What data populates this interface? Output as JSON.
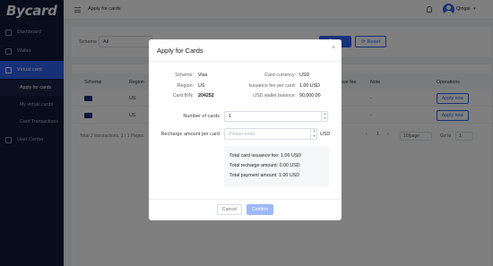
{
  "brand": {
    "logo": "Bycard",
    "accent": "#2f63f2",
    "sidebar_bg": "#0f1a35"
  },
  "sidebar": {
    "items": [
      {
        "label": "Dashboard",
        "icon": "dashboard-icon"
      },
      {
        "label": "Wallet",
        "icon": "wallet-icon"
      },
      {
        "label": "Virtual card",
        "icon": "card-icon",
        "active": true
      },
      {
        "label": "User Center",
        "icon": "user-icon"
      }
    ],
    "subitems": [
      {
        "label": "Apply for cards",
        "active": true
      },
      {
        "label": "My virtual cards"
      },
      {
        "label": "Card Transactions"
      }
    ]
  },
  "topbar": {
    "title": "Apply for cards",
    "user": "Qingsi",
    "user_chevron": "▾"
  },
  "filter": {
    "scheme_label": "Scheme",
    "scheme_value": "All",
    "query_label": "Query",
    "reset_label": "Reset"
  },
  "table": {
    "headers": [
      "Scheme",
      "Region",
      "Issue fee",
      "Note",
      "Operations"
    ],
    "rows": [
      {
        "scheme_icon": "visa-icon",
        "region": "US",
        "note": "-",
        "action": "Apply now"
      },
      {
        "scheme_icon": "visa-icon",
        "region": "US",
        "note": "-",
        "action": "Apply now"
      }
    ],
    "total": "Total 2 transactions, 1 / 1 Pages",
    "pager": {
      "prev": "‹",
      "current": "1",
      "next": "›",
      "page_size": "10/page",
      "goto_label": "Go to",
      "goto_value": "1"
    }
  },
  "modal": {
    "title": "Apply for Cards",
    "close": "×",
    "info_left": [
      {
        "label": "Scheme:",
        "value": "Visa"
      },
      {
        "label": "Region:",
        "value": "US"
      },
      {
        "label": "Card BIN:",
        "value": "204252"
      }
    ],
    "info_right": [
      {
        "label": "Card currency:",
        "value": "USD"
      },
      {
        "label": "Issuance fee per card:",
        "value": "1.00  USD"
      },
      {
        "label": "USD wallet balance:",
        "value": "90,000.00"
      }
    ],
    "number_label": "Number of cards",
    "number_value": "1",
    "amount_label": "Recharge amount per card",
    "amount_placeholder": "Please enter",
    "amount_unit": "USD",
    "summary": [
      "Total card issuance fee:  1.00  USD",
      "Total recharge amount:  0.00  USD",
      "Total payment amount:  1.00  USD"
    ],
    "cancel_label": "Cancel",
    "confirm_label": "Confirm"
  }
}
